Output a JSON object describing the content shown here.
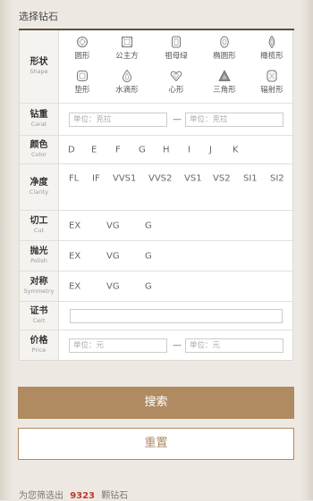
{
  "title": "选择钻石",
  "shape": {
    "label_cn": "形状",
    "label_en": "Shape",
    "items": [
      {
        "name": "圆形",
        "icon": "round-icon"
      },
      {
        "name": "公主方",
        "icon": "princess-icon"
      },
      {
        "name": "祖母绿",
        "icon": "emerald-icon"
      },
      {
        "name": "椭圆形",
        "icon": "oval-icon"
      },
      {
        "name": "橄榄形",
        "icon": "marquise-icon"
      },
      {
        "name": "垫形",
        "icon": "cushion-icon"
      },
      {
        "name": "水滴形",
        "icon": "pear-icon"
      },
      {
        "name": "心形",
        "icon": "heart-icon"
      },
      {
        "name": "三角形",
        "icon": "trillion-icon"
      },
      {
        "name": "辐射形",
        "icon": "radiant-icon"
      }
    ]
  },
  "carat": {
    "label_cn": "钻重",
    "label_en": "Carat",
    "min_placeholder": "单位：克拉",
    "max_placeholder": "单位：克拉",
    "separator": "—"
  },
  "color": {
    "label_cn": "颜色",
    "label_en": "Color",
    "options": [
      "D",
      "E",
      "F",
      "G",
      "H",
      "I",
      "J",
      "K"
    ]
  },
  "clarity": {
    "label_cn": "净度",
    "label_en": "Clarity",
    "options": [
      "FL",
      "IF",
      "VVS1",
      "VVS2",
      "VS1",
      "VS2",
      "SI1",
      "SI2"
    ]
  },
  "cut": {
    "label_cn": "切工",
    "label_en": "Cut",
    "options": [
      "EX",
      "VG",
      "G"
    ]
  },
  "polish": {
    "label_cn": "抛光",
    "label_en": "Polish",
    "options": [
      "EX",
      "VG",
      "G"
    ]
  },
  "symmetry": {
    "label_cn": "对称",
    "label_en": "Symmetry",
    "options": [
      "EX",
      "VG",
      "G"
    ]
  },
  "cert": {
    "label_cn": "证书",
    "label_en": "Cert",
    "value": ""
  },
  "price": {
    "label_cn": "价格",
    "label_en": "Price",
    "min_placeholder": "单位：元",
    "max_placeholder": "单位：元",
    "separator": "—"
  },
  "buttons": {
    "search": "搜索",
    "reset": "重置"
  },
  "footer": {
    "prefix": "为您筛选出",
    "count": "9323",
    "suffix": "颗钻石"
  }
}
